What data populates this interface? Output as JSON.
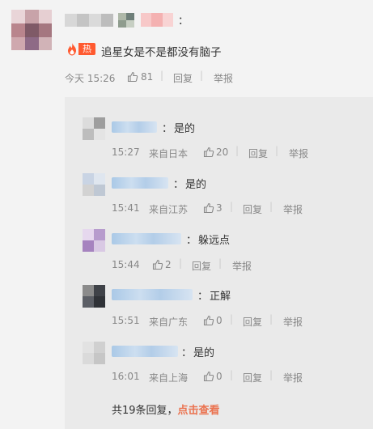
{
  "comment": {
    "separator": "：",
    "badge": "热",
    "text": "追星女是不是都没有脑子",
    "time": "今天 15:26",
    "likes": "81",
    "reply_label": "回复",
    "report_label": "举报"
  },
  "replies": [
    {
      "text": "是的",
      "time": "15:27",
      "source": "来自日本",
      "likes": "20"
    },
    {
      "text": "是的",
      "time": "15:41",
      "source": "来自江苏",
      "likes": "3"
    },
    {
      "text": "躲远点",
      "time": "15:44",
      "source": "",
      "likes": "2"
    },
    {
      "text": "正解",
      "time": "15:51",
      "source": "来自广东",
      "likes": "0"
    },
    {
      "text": "是的",
      "time": "16:01",
      "source": "来自上海",
      "likes": "0"
    }
  ],
  "reply_colon": "：",
  "reply_label": "回复",
  "report_label": "举报",
  "footer": {
    "count_text": "共19条回复，",
    "view_link": "点击查看"
  },
  "colors": {
    "accent": "#eb7350",
    "hot_badge": "#ff5a30",
    "meta_text": "#888888",
    "replies_bg": "#eaeaea",
    "page_bg": "#f3f3f3"
  },
  "icons": {
    "like": "thumbs-up-icon",
    "hot": "flame-icon"
  }
}
